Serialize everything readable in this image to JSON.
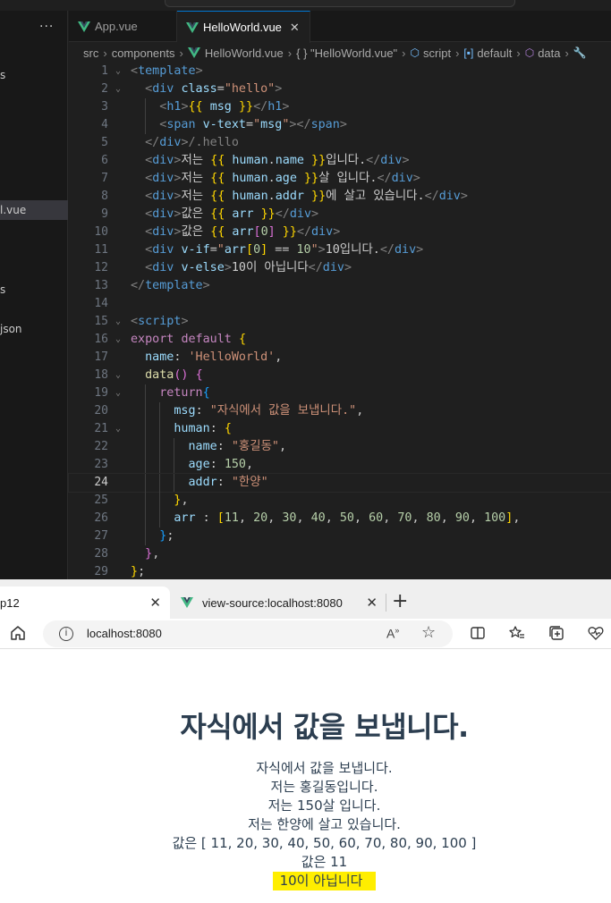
{
  "vscode": {
    "explorer": {
      "more_label": "···",
      "items": [
        {
          "label": "s"
        },
        {
          "label": "l.vue"
        },
        {
          "label": "s"
        },
        {
          "label": "json"
        }
      ]
    },
    "tabs": [
      {
        "label": "App.vue",
        "active": false
      },
      {
        "label": "HelloWorld.vue",
        "active": true,
        "close": "✕"
      }
    ],
    "breadcrumb": {
      "segments": [
        "src",
        "components",
        "HelloWorld.vue",
        "{ } \"HelloWorld.vue\"",
        "script",
        "default",
        "data"
      ]
    },
    "current_line": 24
  },
  "browser": {
    "tabs": [
      {
        "label": "p12",
        "close": "✕"
      },
      {
        "label": "view-source:localhost:8080",
        "close": "✕"
      }
    ],
    "new_tab": "+",
    "url": "localhost:8080",
    "read_aloud": "A",
    "read_aloud_sup": "»"
  },
  "page": {
    "h1": "자식에서 값을 보냅니다.",
    "lines": [
      "자식에서 값을 보냅니다.",
      "저는 홍길동입니다.",
      "저는 150살 입니다.",
      "저는 한양에 살고 있습니다.",
      "값은 [ 11, 20, 30, 40, 50, 60, 70, 80, 90, 100 ]",
      "값은 11"
    ],
    "else_line": "10이 아닙니다"
  },
  "colors": {
    "editor_bg": "#1f1f1f",
    "vue_green": "#41b883",
    "vue_dark": "#35495e",
    "page_text": "#2c3e50",
    "highlight": "#ffee00"
  }
}
